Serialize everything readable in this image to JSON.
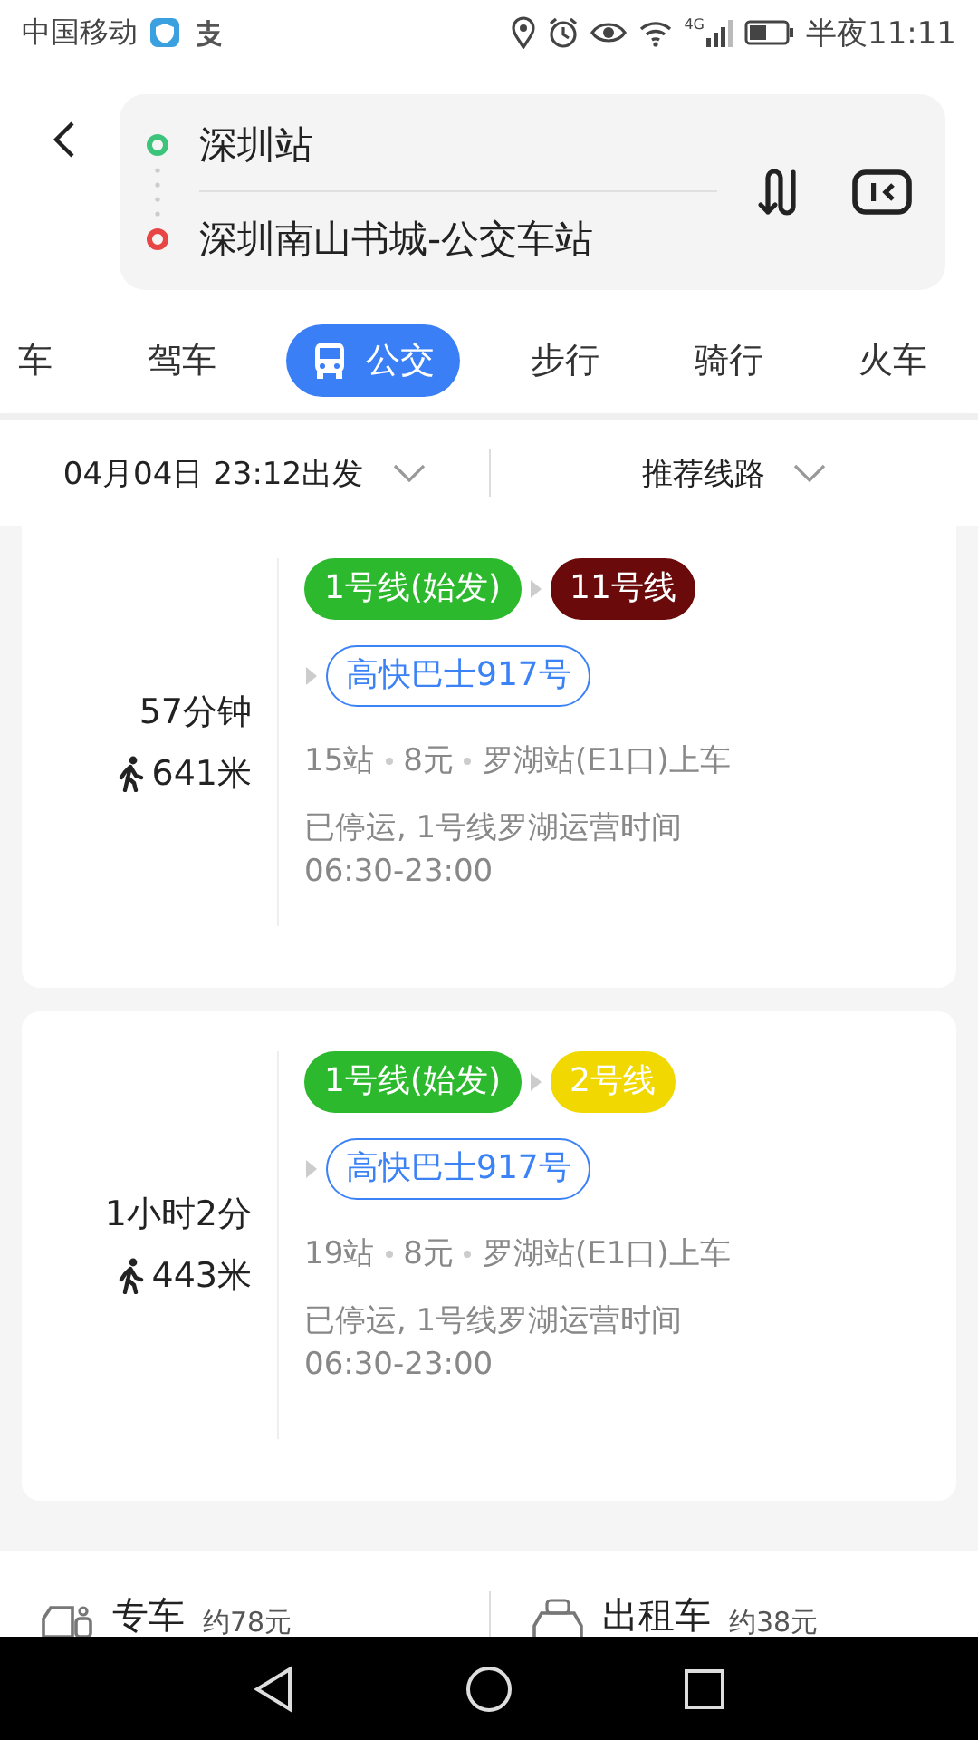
{
  "status_bar": {
    "carrier": "中国移动",
    "network": "4G",
    "time": "半夜11:11"
  },
  "route": {
    "from": "深圳站",
    "to": "深圳南山书城-公交车站"
  },
  "modes": [
    {
      "label": "车",
      "selected": false
    },
    {
      "label": "驾车",
      "selected": false
    },
    {
      "label": "公交",
      "selected": true
    },
    {
      "label": "步行",
      "selected": false
    },
    {
      "label": "骑行",
      "selected": false
    },
    {
      "label": "火车",
      "selected": false
    }
  ],
  "filters": [
    {
      "label": "04月04日 23:12出发"
    },
    {
      "label": "推荐线路"
    }
  ],
  "routes": [
    {
      "duration": "57分钟",
      "walk": "641米",
      "rows": [
        [
          {
            "label": "1号线(始发)",
            "color": "#2db92d",
            "kind": "filled"
          },
          {
            "label": "11号线",
            "color": "#6b0a0a",
            "kind": "filled"
          }
        ],
        [
          {
            "label": "高快巴士917号",
            "color": "#3b82f6",
            "kind": "outline"
          }
        ]
      ],
      "info": [
        "15站",
        "8元",
        "罗湖站(E1口)上车"
      ],
      "notice": [
        "已停运, 1号线罗湖运营时间",
        "06:30-23:00"
      ]
    },
    {
      "duration": "1小时2分",
      "walk": "443米",
      "rows": [
        [
          {
            "label": "1号线(始发)",
            "color": "#2db92d",
            "kind": "filled"
          },
          {
            "label": "2号线",
            "color": "#f0d800",
            "kind": "filled"
          }
        ],
        [
          {
            "label": "高快巴士917号",
            "color": "#3b82f6",
            "kind": "outline"
          }
        ]
      ],
      "info": [
        "19站",
        "8元",
        "罗湖站(E1口)上车"
      ],
      "notice": [
        "已停运, 1号线罗湖运营时间",
        "06:30-23:00"
      ]
    }
  ],
  "taxi_options": [
    {
      "kind": "car",
      "label": "专车",
      "price": "约78元"
    },
    {
      "kind": "taxi",
      "label": "出租车",
      "price": "约38元"
    }
  ]
}
